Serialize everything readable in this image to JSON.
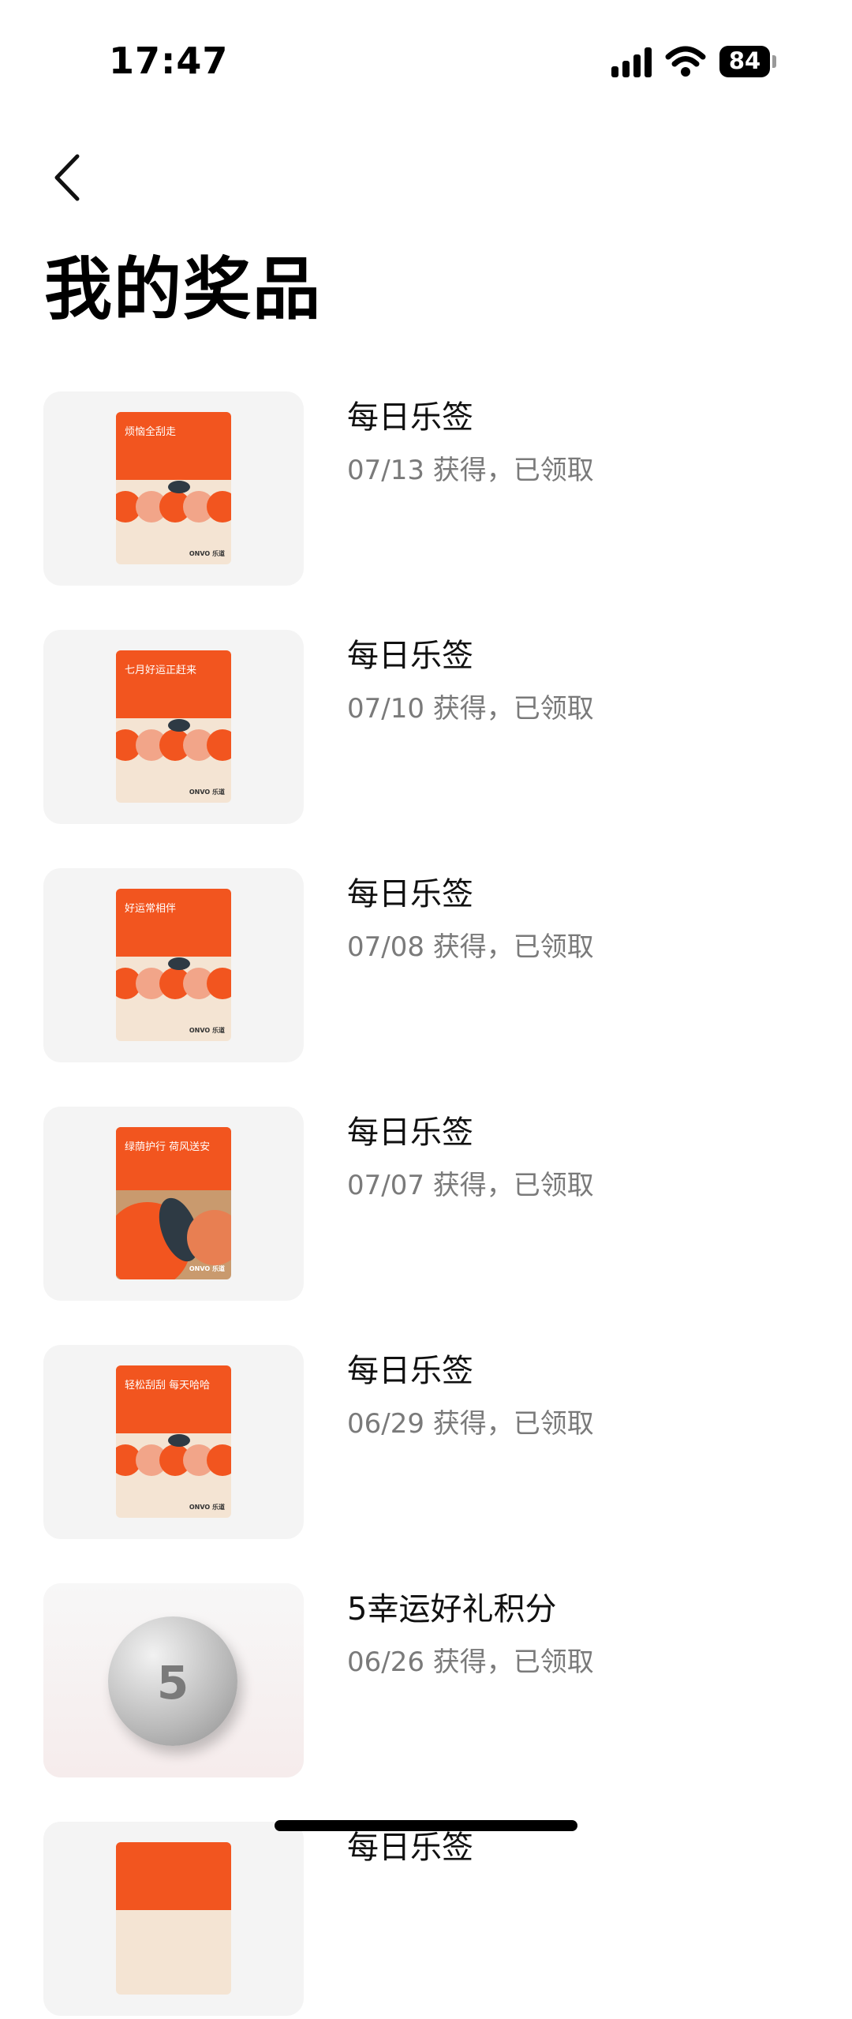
{
  "status_bar": {
    "time": "17:47",
    "battery": "84"
  },
  "header": {
    "title": "我的奖品"
  },
  "prizes": [
    {
      "title": "每日乐签",
      "subtitle": "07/13 获得，已领取",
      "card_text": "烦恼全刮走",
      "logo": "ONVO 乐道"
    },
    {
      "title": "每日乐签",
      "subtitle": "07/10 获得，已领取",
      "card_text": "七月好运正赶来",
      "logo": "ONVO 乐道"
    },
    {
      "title": "每日乐签",
      "subtitle": "07/08 获得，已领取",
      "card_text": "好运常相伴",
      "logo": "ONVO 乐道"
    },
    {
      "title": "每日乐签",
      "subtitle": "07/07 获得，已领取",
      "card_text": "绿荫护行 荷风送安",
      "logo": "ONVO 乐道"
    },
    {
      "title": "每日乐签",
      "subtitle": "06/29 获得，已领取",
      "card_text": "轻松刮刮 每天哈哈",
      "logo": "ONVO 乐道"
    },
    {
      "title": "5幸运好礼积分",
      "subtitle": "06/26 获得，已领取",
      "coin_number": "5"
    },
    {
      "title": "每日乐签",
      "subtitle": ""
    }
  ]
}
